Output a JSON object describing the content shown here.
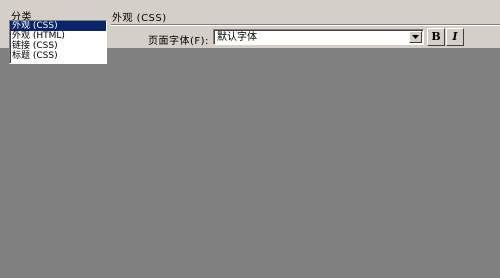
{
  "category_panel": {
    "heading": "分类",
    "items": [
      {
        "label": "外观 (CSS)",
        "selected": true
      },
      {
        "label": "外观 (HTML)",
        "selected": false
      },
      {
        "label": "链接 (CSS)",
        "selected": false
      },
      {
        "label": "标题 (CSS)",
        "selected": false
      }
    ]
  },
  "section": {
    "title": "外观 (CSS)"
  },
  "page_font": {
    "label": "页面字体(F):",
    "value": "默认字体"
  },
  "style_buttons": {
    "bold_label": "B",
    "italic_label": "I"
  },
  "colors": {
    "dialog_bg": "#d4d0c8",
    "overlay_gray": "#808080",
    "selection_bg": "#0a246a",
    "selection_text": "#ffffff"
  },
  "icons": {
    "dropdown_arrow": "chevron-down-icon"
  }
}
